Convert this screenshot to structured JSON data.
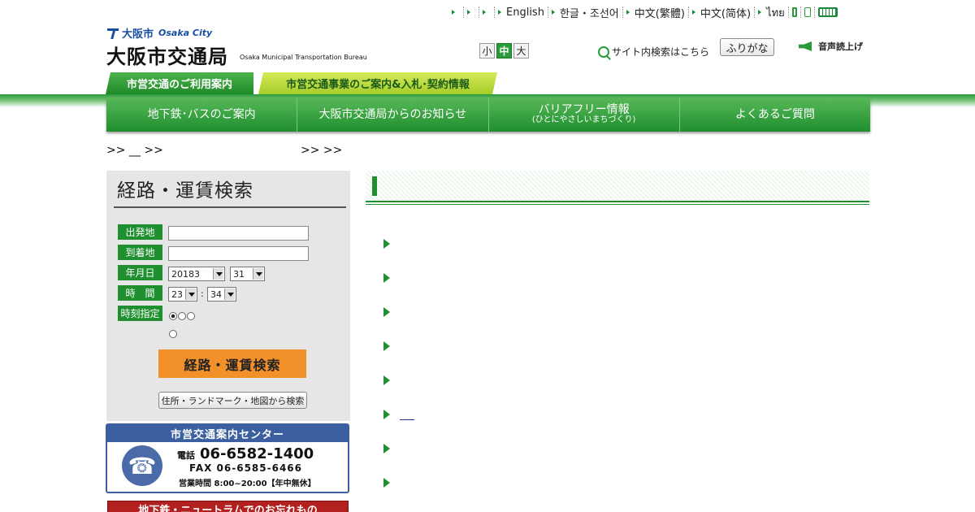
{
  "topbar": {
    "links": [
      "",
      "",
      "",
      "English",
      "한글・조선어",
      "中文(繁體)",
      "中文(简体)",
      "ไทย"
    ]
  },
  "logo": {
    "city_jp": "大阪市",
    "city_en": "Osaka City",
    "bureau_jp": "大阪市交通局",
    "bureau_en": "Osaka Municipal Transportation Bureau"
  },
  "font_size": {
    "small": "小",
    "medium": "中",
    "large": "大"
  },
  "site_search": "サイト内検索はこちら",
  "furigana": "ふりがな",
  "voice": "音声読上げ",
  "tabs": [
    "市営交通のご利用案内",
    "市営交通事業のご案内&入札･契約情報"
  ],
  "nav": [
    {
      "label": "地下鉄･バスのご案内",
      "sub": ""
    },
    {
      "label": "大阪市交通局からのお知らせ",
      "sub": ""
    },
    {
      "label": "バリアフリー情報",
      "sub": "(ひとにやさしいまちづくり)"
    },
    {
      "label": "よくあるご質問",
      "sub": ""
    }
  ],
  "breadcrumb": {
    "left": ">>  __  >>",
    "right": ">> >>"
  },
  "route_search": {
    "title": "経路・運賃検索",
    "labels": {
      "from": "出発地",
      "to": "到着地",
      "date": "年月日",
      "time": "時　間",
      "time_spec": "時刻指定"
    },
    "year_month": "20183",
    "day": "31",
    "hour": "23",
    "minute": "34",
    "colon": ":",
    "submit": "経路・運賃検索",
    "map_search": "住所・ランドマーク・地図から検索"
  },
  "info_center": {
    "title": "市営交通案内センター",
    "tel_label": "電話",
    "tel": "06-6582-1400",
    "fax": "FAX  06-6585-6466",
    "hours": "営業時間 8:00~20:00【年中無休】"
  },
  "lost_found": "地下鉄・ニュートラムでのお忘れもの",
  "colors": {
    "green": "#1f8f2f",
    "lime": "#a6cc2a",
    "orange": "#f2902a",
    "navy": "#3b5fa0",
    "red": "#b32020"
  }
}
